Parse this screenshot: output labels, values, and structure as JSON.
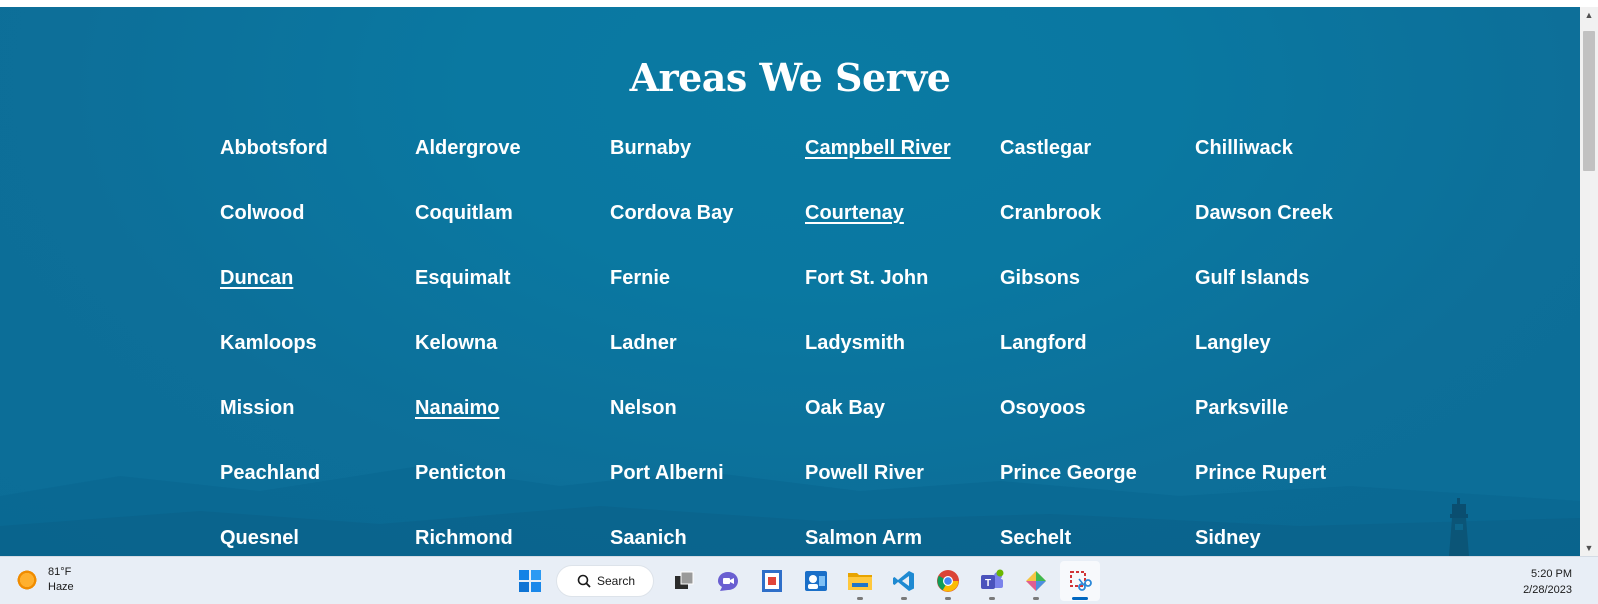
{
  "page": {
    "heading": "Areas We Serve",
    "areas": [
      {
        "name": "Abbotsford",
        "linked": false
      },
      {
        "name": "Aldergrove",
        "linked": false
      },
      {
        "name": "Burnaby",
        "linked": false
      },
      {
        "name": "Campbell River",
        "linked": true
      },
      {
        "name": "Castlegar",
        "linked": false
      },
      {
        "name": "Chilliwack",
        "linked": false
      },
      {
        "name": "Colwood",
        "linked": false
      },
      {
        "name": "Coquitlam",
        "linked": false
      },
      {
        "name": "Cordova Bay",
        "linked": false
      },
      {
        "name": "Courtenay",
        "linked": true
      },
      {
        "name": "Cranbrook",
        "linked": false
      },
      {
        "name": "Dawson Creek",
        "linked": false
      },
      {
        "name": "Duncan",
        "linked": true
      },
      {
        "name": "Esquimalt",
        "linked": false
      },
      {
        "name": "Fernie",
        "linked": false
      },
      {
        "name": "Fort St. John",
        "linked": false
      },
      {
        "name": "Gibsons",
        "linked": false
      },
      {
        "name": "Gulf Islands",
        "linked": false
      },
      {
        "name": "Kamloops",
        "linked": false
      },
      {
        "name": "Kelowna",
        "linked": false
      },
      {
        "name": "Ladner",
        "linked": false
      },
      {
        "name": "Ladysmith",
        "linked": false
      },
      {
        "name": "Langford",
        "linked": false
      },
      {
        "name": "Langley",
        "linked": false
      },
      {
        "name": "Mission",
        "linked": false
      },
      {
        "name": "Nanaimo",
        "linked": true
      },
      {
        "name": "Nelson",
        "linked": false
      },
      {
        "name": "Oak Bay",
        "linked": false
      },
      {
        "name": "Osoyoos",
        "linked": false
      },
      {
        "name": "Parksville",
        "linked": false
      },
      {
        "name": "Peachland",
        "linked": false
      },
      {
        "name": "Penticton",
        "linked": false
      },
      {
        "name": "Port Alberni",
        "linked": false
      },
      {
        "name": "Powell River",
        "linked": false
      },
      {
        "name": "Prince George",
        "linked": false
      },
      {
        "name": "Prince Rupert",
        "linked": false
      },
      {
        "name": "Quesnel",
        "linked": false
      },
      {
        "name": "Richmond",
        "linked": false
      },
      {
        "name": "Saanich",
        "linked": false
      },
      {
        "name": "Salmon Arm",
        "linked": false
      },
      {
        "name": "Sechelt",
        "linked": false
      },
      {
        "name": "Sidney",
        "linked": false
      }
    ],
    "background_color": "#0b7099",
    "text_color": "#ffffff"
  },
  "taskbar": {
    "weather": {
      "temp": "81°F",
      "condition": "Haze",
      "icon": "sun-haze-icon"
    },
    "search_label": "Search",
    "apps": [
      {
        "icon": "windows-start-icon",
        "running": false
      },
      {
        "icon": "task-view-icon",
        "running": false
      },
      {
        "icon": "teams-chat-icon",
        "running": false
      },
      {
        "icon": "presentation-app-icon",
        "running": false
      },
      {
        "icon": "contacts-app-icon",
        "running": false
      },
      {
        "icon": "file-explorer-icon",
        "running": true
      },
      {
        "icon": "vscode-icon",
        "running": true
      },
      {
        "icon": "chrome-icon",
        "running": true
      },
      {
        "icon": "teams-icon",
        "running": true
      },
      {
        "icon": "paint-app-icon",
        "running": true
      },
      {
        "icon": "snipping-tool-icon",
        "running": true,
        "active": true
      }
    ],
    "clock": {
      "time": "5:20 PM",
      "date": "2/28/2023"
    }
  }
}
